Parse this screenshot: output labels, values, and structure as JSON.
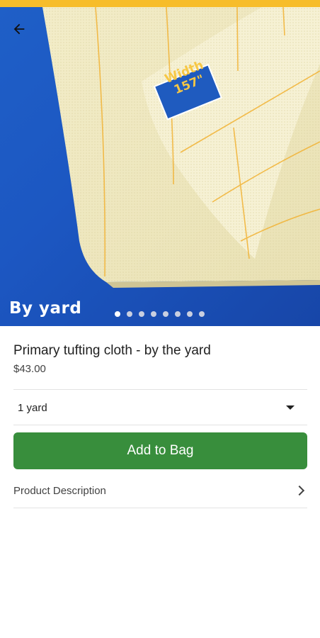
{
  "hero": {
    "caption": "By yard",
    "tag_line1": "Width",
    "tag_line2": "157\"",
    "slide_count": 8,
    "active_slide": 0
  },
  "product": {
    "title": "Primary tufting cloth - by the yard",
    "price": "$43.00"
  },
  "quantity_select": {
    "selected": "1 yard"
  },
  "actions": {
    "add_to_bag": "Add to Bag"
  },
  "description_row": {
    "label": "Product Description"
  },
  "colors": {
    "status_strip": "#f7bd2a",
    "hero_background": "#1c57c2",
    "add_button": "#388e3c"
  },
  "icons": {
    "back": "arrow-left-icon",
    "quantity_dropdown": "caret-down-icon",
    "description": "chevron-right-icon"
  }
}
